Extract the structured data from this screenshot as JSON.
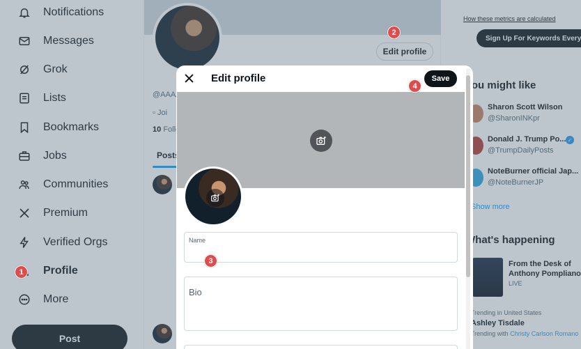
{
  "sidebar": {
    "items": [
      {
        "label": "Notifications",
        "icon": "bell-icon"
      },
      {
        "label": "Messages",
        "icon": "envelope-icon"
      },
      {
        "label": "Grok",
        "icon": "grok-icon"
      },
      {
        "label": "Lists",
        "icon": "list-icon"
      },
      {
        "label": "Bookmarks",
        "icon": "bookmark-icon"
      },
      {
        "label": "Jobs",
        "icon": "briefcase-icon"
      },
      {
        "label": "Communities",
        "icon": "people-icon"
      },
      {
        "label": "Premium",
        "icon": "x-logo-icon"
      },
      {
        "label": "Verified Orgs",
        "icon": "lightning-icon"
      },
      {
        "label": "Profile",
        "icon": "person-icon"
      },
      {
        "label": "More",
        "icon": "more-circle-icon"
      }
    ],
    "post_label": "Post"
  },
  "main": {
    "edit_profile_label": "Edit profile",
    "handle": "@AAAA",
    "joined": "Joi",
    "follow_count": "10",
    "follow_text": "Follo",
    "tab_posts": "Posts"
  },
  "right": {
    "metrics_link": "How these metrics are calculated",
    "keywords_button": "Sign Up For Keywords Everyw",
    "might_like_title": "You might like",
    "suggestions": [
      {
        "name": "Sharon Scott Wilson",
        "handle": "@SharonINKpr"
      },
      {
        "name": "Donald J. Trump Po...",
        "handle": "@TrumpDailyPosts"
      },
      {
        "name": "NoteBurner official Jap...",
        "handle": "@NoteBurnerJP"
      }
    ],
    "show_more": "Show more",
    "happening_title": "What's happening",
    "happening_item": "From the Desk of Anthony Pompliano",
    "happening_status": "LIVE",
    "trend_location": "Trending in United States",
    "trend_name": "Ashley Tisdale",
    "trend_with_prefix": "Trending with",
    "trend_with_name": "Christy Carlson Romano"
  },
  "modal": {
    "title": "Edit profile",
    "save_label": "Save",
    "name_label": "Name",
    "bio_label": "Bio"
  },
  "badges": [
    "1",
    "2",
    "3",
    "4"
  ],
  "colors": {
    "accent": "#1d9bf0",
    "primary_button": "#0f1419",
    "badge": "#e04b4b"
  }
}
